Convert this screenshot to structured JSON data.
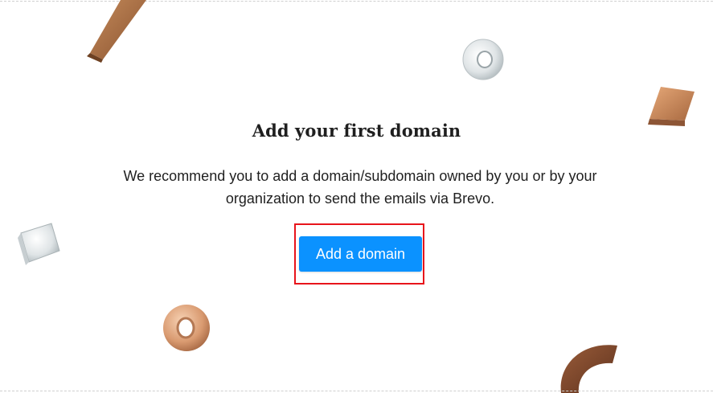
{
  "empty_state": {
    "title": "Add your first domain",
    "description": "We recommend you to add a domain/subdomain owned by you or by your organization to send the emails via Brevo.",
    "button_label": "Add a domain"
  },
  "colors": {
    "button": "#0b92ff",
    "highlight": "#e8141b",
    "text": "#1f1f1f"
  },
  "decorations": [
    "wood-plank",
    "glass-ring",
    "copper-tile",
    "glass-cube",
    "copper-ring",
    "wood-arc"
  ]
}
